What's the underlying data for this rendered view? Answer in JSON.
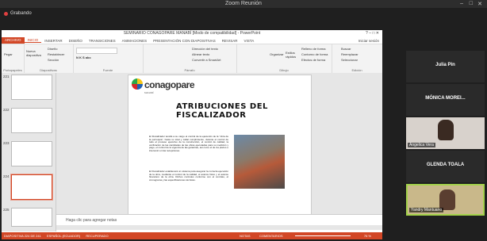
{
  "zoom": {
    "title": "Zoom Reunión",
    "recording_label": "Grabando"
  },
  "ppt": {
    "title": "SEMINARIO CONAGOPARE MANABÍ [Modo de compatibilidad] - PowerPoint",
    "login": "Iniciar sesión",
    "tabs": [
      "ARCHIVO",
      "INICIO",
      "INSERTAR",
      "DISEÑO",
      "TRANSICIONES",
      "ANIMACIONES",
      "PRESENTACIÓN CON DIAPOSITIVAS",
      "REVISAR",
      "VISTA"
    ],
    "ribbon_groups": [
      "Portapapeles",
      "Diapositivas",
      "Fuente",
      "Párrafo",
      "Dibujo",
      "Edición"
    ],
    "ribbon_buttons": {
      "paste": "Pegar",
      "new_slide": "Nueva diapositiva",
      "design": "Diseño",
      "reset": "Restablecer",
      "section": "Sección",
      "text_direction": "Dirección del texto",
      "align_text": "Alinear texto",
      "smartart": "Convertir a SmartArt",
      "arrange": "Organizar",
      "quick_styles": "Estilos rápidos",
      "fill": "Relleno de forma",
      "outline": "Contorno de forma",
      "effects": "Efectos de forma",
      "find": "Buscar",
      "replace": "Reemplazar",
      "select": "Seleccionar"
    },
    "thumb_numbers": [
      "221",
      "222",
      "223",
      "224",
      "225"
    ],
    "notes_placeholder": "Haga clic para agregar notas",
    "status": {
      "slide": "DIAPOSITIVA 224 DE 241",
      "lang": "ESPAÑOL (ECUADOR)",
      "recovered": "RECUPERADO",
      "notes": "NOTAS",
      "comments": "COMENTARIOS",
      "zoom": "76 %"
    }
  },
  "slide": {
    "logo": "conagopare",
    "logo_sub": "MANABÍ",
    "title": "ATRIBUCIONES DEL FISCALIZADOR",
    "para1": "El Fiscalizador tendrá a su cargo el control de la ejecución de la \"obra de la parroquia\", hasta su total y cabal cumplimiento, durante el control de todo el proceso ejecutivo de la construcción, el control de calidad, la verificación de las cantidades de las obras ejecutadas para su medición y pago, el control de la vigencia de las garantías, así como el de los plazos e intervenir en las recepciones.",
    "para2": "El Fiscalizador establecerá un sistema para asegurar la correcta ejecución de la obra, mediante el control de la calidad, el avance físico y el avance financiero de la obra. Dichos controles conforme con el contrato, el cronograma y las especificaciones técnicas."
  },
  "participants": [
    {
      "name": "Julia Pin",
      "label": "",
      "type": "name"
    },
    {
      "name": "MÓNICA MOREI...",
      "label": "",
      "type": "name"
    },
    {
      "name": "",
      "label": "Angelica Vera",
      "type": "video"
    },
    {
      "name": "GLENDA TOALA",
      "label": "",
      "type": "name"
    },
    {
      "name": "",
      "label": "Yandry Mantuano",
      "type": "video-active"
    }
  ]
}
